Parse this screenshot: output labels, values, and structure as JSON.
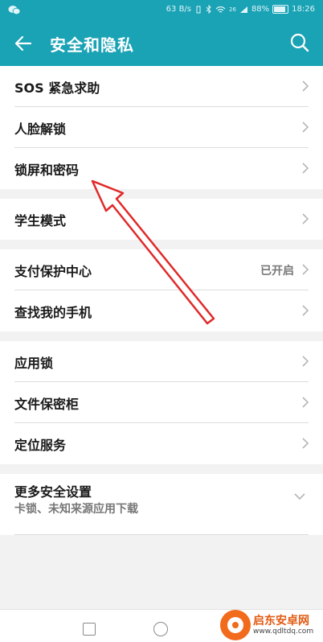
{
  "status_bar": {
    "net_speed": "63 B/s",
    "signal_label": "26",
    "battery": "88%",
    "battery_level": 0.88,
    "time": "18:26"
  },
  "app_bar": {
    "title": "安全和隐私"
  },
  "sections": [
    {
      "items": [
        {
          "label": "SOS 紧急求助"
        },
        {
          "label": "人脸解锁"
        },
        {
          "label": "锁屏和密码"
        }
      ]
    },
    {
      "items": [
        {
          "label": "学生模式"
        }
      ]
    },
    {
      "items": [
        {
          "label": "支付保护中心",
          "value": "已开启"
        },
        {
          "label": "查找我的手机"
        }
      ]
    },
    {
      "items": [
        {
          "label": "应用锁"
        },
        {
          "label": "文件保密柜"
        },
        {
          "label": "定位服务"
        }
      ]
    },
    {
      "items": [
        {
          "label": "更多安全设置",
          "subtitle": "卡锁、未知来源应用下载"
        }
      ]
    }
  ],
  "annotation": {
    "arrow_color": "#e02a2a"
  },
  "watermark": {
    "name": "启东安卓网",
    "url": "www.qdltdq.com"
  },
  "colors": {
    "accent": "#1aa2b5"
  }
}
